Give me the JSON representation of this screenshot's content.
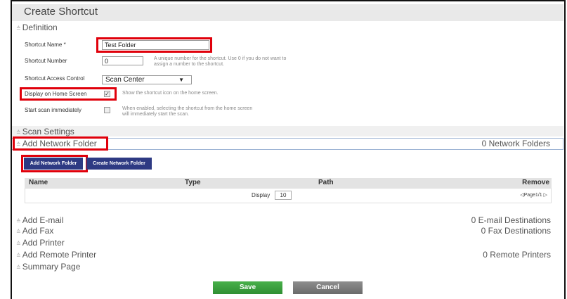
{
  "window": {
    "title": "Create Shortcut"
  },
  "definition": {
    "section_label": "Definition",
    "shortcut_name_label": "Shortcut Name *",
    "shortcut_name_value": "Test Folder",
    "shortcut_number_label": "Shortcut Number",
    "shortcut_number_value": "0",
    "shortcut_number_hint_1": "A unique number for the shortcut. Use 0 if you do not want to",
    "shortcut_number_hint_2": "assign a number to the shortcut.",
    "access_control_label": "Shortcut Access Control",
    "access_control_value": "Scan Center",
    "display_home_label": "Display on Home Screen",
    "display_home_checked": true,
    "display_home_hint": "Show the shortcut icon on the home screen.",
    "start_scan_label": "Start scan immediately",
    "start_scan_checked": false,
    "start_scan_hint_1": "When enabled, selecting the shortcut from the home screen",
    "start_scan_hint_2": "will immediately start the scan."
  },
  "scan_settings": {
    "label": "Scan Settings"
  },
  "network_folder": {
    "label": "Add Network Folder",
    "count": "0 Network Folders",
    "add_button": "Add Network Folder",
    "create_button": "Create Network Folder",
    "table": {
      "columns": [
        "Name",
        "Type",
        "Path",
        "Remove"
      ],
      "display_label": "Display",
      "display_value": "10",
      "pager": "◁Page1/1 ▷"
    }
  },
  "sections": [
    {
      "label": "Add E-mail",
      "count": "0 E-mail Destinations"
    },
    {
      "label": "Add Fax",
      "count": "0 Fax Destinations"
    },
    {
      "label": "Add Printer",
      "count": ""
    },
    {
      "label": "Add Remote Printer",
      "count": "0 Remote Printers"
    },
    {
      "label": "Summary Page",
      "count": ""
    }
  ],
  "footer": {
    "save_label": "Save",
    "cancel_label": "Cancel"
  },
  "colors": {
    "highlight": "#e0000b",
    "button_blue": "#2e3a83",
    "save_green": "#3ca03f",
    "cancel_gray": "#7a7a7a"
  },
  "icons": {
    "collapse": "double-chevron-up-icon",
    "expand": "double-chevron-down-icon"
  }
}
